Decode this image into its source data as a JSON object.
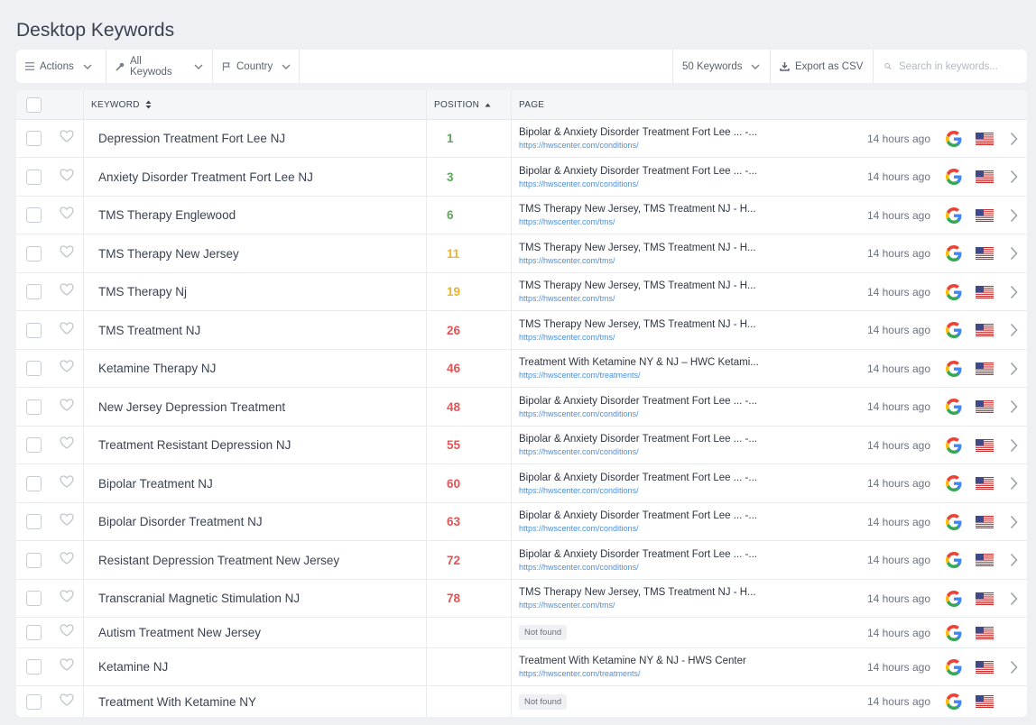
{
  "title": "Desktop Keywords",
  "toolbar": {
    "actions_label": "Actions",
    "all_keywords_label": "All Keywods",
    "country_label": "Country",
    "keywords_count_label": "50 Keywords",
    "export_label": "Export as CSV",
    "search_placeholder": "Search in keywords..."
  },
  "table": {
    "headers": {
      "keyword": "KEYWORD",
      "position": "POSITION",
      "page": "PAGE"
    },
    "rows": [
      {
        "keyword": "Depression Treatment Fort Lee NJ",
        "position": "1",
        "pos_color": "green",
        "page_title": "Bipolar & Anxiety Disorder Treatment Fort Lee ... -...",
        "page_url": "https://hwscenter.com/conditions/",
        "time": "14 hours ago",
        "has_arrow": true
      },
      {
        "keyword": "Anxiety Disorder Treatment Fort Lee NJ",
        "position": "3",
        "pos_color": "green",
        "page_title": "Bipolar & Anxiety Disorder Treatment Fort Lee ... -...",
        "page_url": "https://hwscenter.com/conditions/",
        "time": "14 hours ago",
        "has_arrow": true
      },
      {
        "keyword": "TMS Therapy Englewood",
        "position": "6",
        "pos_color": "green",
        "page_title": "TMS Therapy New Jersey, TMS Treatment NJ - H...",
        "page_url": "https://hwscenter.com/tms/",
        "time": "14 hours ago",
        "has_arrow": true
      },
      {
        "keyword": "TMS Therapy New Jersey",
        "position": "11",
        "pos_color": "amber",
        "page_title": "TMS Therapy New Jersey, TMS Treatment NJ - H...",
        "page_url": "https://hwscenter.com/tms/",
        "time": "14 hours ago",
        "has_arrow": true
      },
      {
        "keyword": "TMS Therapy Nj",
        "position": "19",
        "pos_color": "amber",
        "page_title": "TMS Therapy New Jersey, TMS Treatment NJ - H...",
        "page_url": "https://hwscenter.com/tms/",
        "time": "14 hours ago",
        "has_arrow": true
      },
      {
        "keyword": "TMS Treatment NJ",
        "position": "26",
        "pos_color": "red",
        "page_title": "TMS Therapy New Jersey, TMS Treatment NJ - H...",
        "page_url": "https://hwscenter.com/tms/",
        "time": "14 hours ago",
        "has_arrow": true
      },
      {
        "keyword": "Ketamine Therapy NJ",
        "position": "46",
        "pos_color": "red",
        "page_title": "Treatment With Ketamine NY & NJ – HWC Ketami...",
        "page_url": "https://hwscenter.com/treatments/",
        "time": "14 hours ago",
        "has_arrow": true
      },
      {
        "keyword": "New Jersey Depression Treatment",
        "position": "48",
        "pos_color": "red",
        "page_title": "Bipolar & Anxiety Disorder Treatment Fort Lee ... -...",
        "page_url": "https://hwscenter.com/conditions/",
        "time": "14 hours ago",
        "has_arrow": true
      },
      {
        "keyword": "Treatment Resistant Depression NJ",
        "position": "55",
        "pos_color": "red",
        "page_title": "Bipolar & Anxiety Disorder Treatment Fort Lee ... -...",
        "page_url": "https://hwscenter.com/conditions/",
        "time": "14 hours ago",
        "has_arrow": true
      },
      {
        "keyword": "Bipolar Treatment NJ",
        "position": "60",
        "pos_color": "red",
        "page_title": "Bipolar & Anxiety Disorder Treatment Fort Lee ... -...",
        "page_url": "https://hwscenter.com/conditions/",
        "time": "14 hours ago",
        "has_arrow": true
      },
      {
        "keyword": "Bipolar Disorder Treatment NJ",
        "position": "63",
        "pos_color": "red",
        "page_title": "Bipolar & Anxiety Disorder Treatment Fort Lee ... -...",
        "page_url": "https://hwscenter.com/conditions/",
        "time": "14 hours ago",
        "has_arrow": true
      },
      {
        "keyword": "Resistant Depression Treatment New Jersey",
        "position": "72",
        "pos_color": "red",
        "page_title": "Bipolar & Anxiety Disorder Treatment Fort Lee ... -...",
        "page_url": "https://hwscenter.com/conditions/",
        "time": "14 hours ago",
        "has_arrow": true
      },
      {
        "keyword": "Transcranial Magnetic Stimulation NJ",
        "position": "78",
        "pos_color": "red",
        "page_title": "TMS Therapy New Jersey, TMS Treatment NJ - H...",
        "page_url": "https://hwscenter.com/tms/",
        "time": "14 hours ago",
        "has_arrow": true
      },
      {
        "keyword": "Autism Treatment New Jersey",
        "position": "",
        "pos_color": "",
        "not_found": "Not found",
        "time": "14 hours ago",
        "has_arrow": false
      },
      {
        "keyword": "Ketamine NJ",
        "position": "",
        "pos_color": "",
        "page_title": "Treatment With Ketamine NY & NJ - HWS Center",
        "page_url": "https://hwscenter.com/treatments/",
        "time": "14 hours ago",
        "has_arrow": true
      },
      {
        "keyword": "Treatment With Ketamine NY",
        "position": "",
        "pos_color": "",
        "not_found": "Not found",
        "time": "14 hours ago",
        "has_arrow": false
      }
    ]
  },
  "icons": {
    "engine": "google-icon",
    "country_flag": "us-flag-icon"
  }
}
